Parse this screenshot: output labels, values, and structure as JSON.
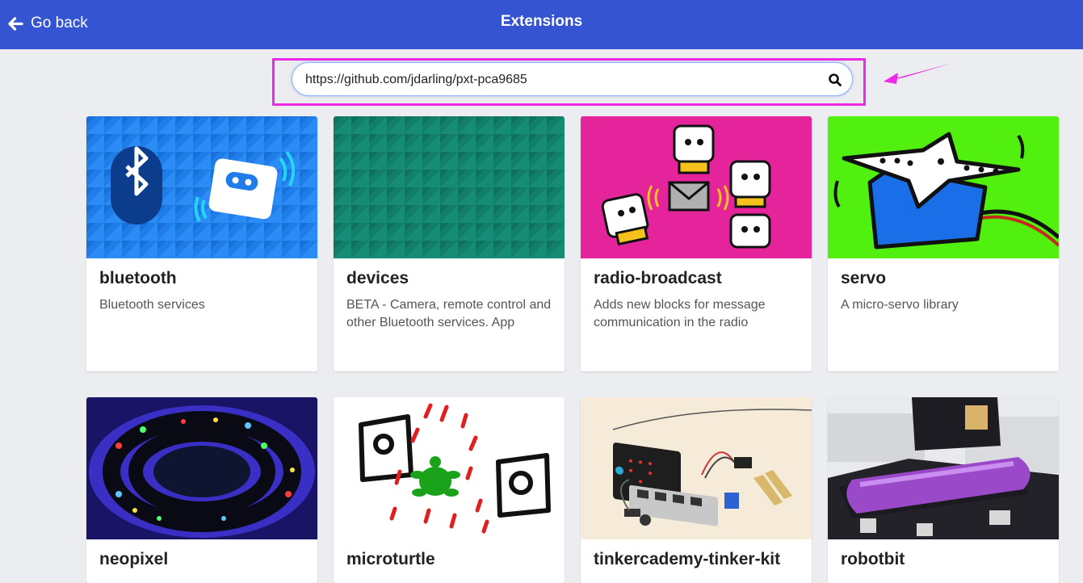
{
  "header": {
    "back_label": "Go back",
    "title": "Extensions",
    "background": "#3454d1"
  },
  "search": {
    "value": "https://github.com/jdarling/pxt-pca9685",
    "icon": "search-icon"
  },
  "annotation": {
    "color": "#ee28e6"
  },
  "extensions": [
    {
      "name": "bluetooth",
      "description": "Bluetooth services"
    },
    {
      "name": "devices",
      "description": "BETA - Camera, remote control and other Bluetooth services. App"
    },
    {
      "name": "radio-broadcast",
      "description": "Adds new blocks for message communication in the radio"
    },
    {
      "name": "servo",
      "description": "A micro-servo library"
    },
    {
      "name": "neopixel",
      "description": ""
    },
    {
      "name": "microturtle",
      "description": ""
    },
    {
      "name": "tinkercademy-tinker-kit",
      "description": ""
    },
    {
      "name": "robotbit",
      "description": ""
    }
  ]
}
